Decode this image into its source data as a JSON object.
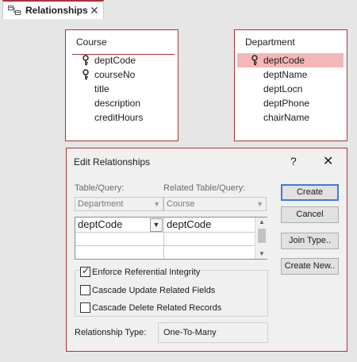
{
  "tab": {
    "title": "Relationships",
    "close": "✕",
    "icon": "relationships-icon"
  },
  "tables": {
    "course": {
      "title": "Course",
      "fields": [
        "deptCode",
        "courseNo",
        "title",
        "description",
        "creditHours"
      ],
      "keys": [
        true,
        true,
        false,
        false,
        false
      ]
    },
    "department": {
      "title": "Department",
      "fields": [
        "deptCode",
        "deptName",
        "deptLocn",
        "deptPhone",
        "chairName"
      ],
      "keys": [
        true,
        false,
        false,
        false,
        false
      ],
      "selected": "deptCode"
    }
  },
  "dialog": {
    "title": "Edit Relationships",
    "help": "?",
    "close": "✕",
    "table_label": "Table/Query:",
    "related_label": "Related Table/Query:",
    "table_value": "Department",
    "related_value": "Course",
    "left_field": "deptCode",
    "right_field": "deptCode",
    "buttons": {
      "create": "Create",
      "cancel": "Cancel",
      "join_type": "Join Type..",
      "create_new": "Create New.."
    },
    "enforce": {
      "label": "Enforce Referential Integrity",
      "checked": true
    },
    "cascade_update": {
      "label": "Cascade Update Related Fields",
      "checked": false
    },
    "cascade_delete": {
      "label": "Cascade Delete Related Records",
      "checked": false
    },
    "rel_type_label": "Relationship Type:",
    "rel_type_value": "One-To-Many"
  },
  "colors": {
    "accent": "#a4373a",
    "selected_field": "#f4b6b6",
    "default_button": "#3f7bd6"
  }
}
